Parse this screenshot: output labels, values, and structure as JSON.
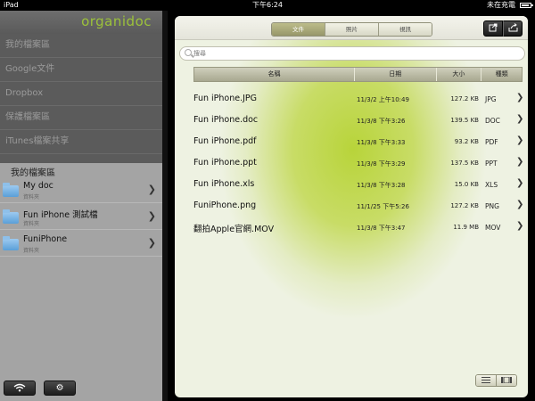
{
  "statusbar": {
    "device": "iPad",
    "time": "下午6:24",
    "charge_label": "未在充電",
    "battery_level": 0.9
  },
  "logo": "organidoc",
  "sources": [
    {
      "label": "我的檔案區",
      "active": true
    },
    {
      "label": "Google文件",
      "active": false
    },
    {
      "label": "Dropbox",
      "active": false
    },
    {
      "label": "保護檔案區",
      "active": false
    },
    {
      "label": "iTunes檔案共享",
      "active": false
    }
  ],
  "folders_label": "我的檔案區",
  "folders": [
    {
      "name": "My doc",
      "sub": "資料夾",
      "selected": false
    },
    {
      "name": "Fun iPhone 測試檔",
      "sub": "資料夾",
      "selected": true
    },
    {
      "name": "FuniPhone",
      "sub": "資料夾",
      "selected": false
    }
  ],
  "segments": [
    {
      "label": "文件",
      "active": true
    },
    {
      "label": "照片",
      "active": false
    },
    {
      "label": "視訊",
      "active": false
    }
  ],
  "search": {
    "placeholder": "搜尋"
  },
  "table": {
    "headers": {
      "name": "名稱",
      "date": "日期",
      "size": "大小",
      "type": "種類"
    },
    "rows": [
      {
        "name": "Fun iPhone.JPG",
        "date": "11/3/2 上午10:49",
        "size": "127.2 KB",
        "type": "JPG"
      },
      {
        "name": "Fun iPhone.doc",
        "date": "11/3/8 下午3:26",
        "size": "139.5 KB",
        "type": "DOC"
      },
      {
        "name": "Fun iPhone.pdf",
        "date": "11/3/8 下午3:33",
        "size": "93.2 KB",
        "type": "PDF"
      },
      {
        "name": "Fun iPhone.ppt",
        "date": "11/3/8 下午3:29",
        "size": "137.5 KB",
        "type": "PPT"
      },
      {
        "name": "Fun iPhone.xls",
        "date": "11/3/8 下午3:28",
        "size": "15.0 KB",
        "type": "XLS"
      },
      {
        "name": "FuniPhone.png",
        "date": "11/1/25 下午5:26",
        "size": "127.2 KB",
        "type": "PNG"
      },
      {
        "name": "翻拍Apple官網.MOV",
        "date": "11/3/8 下午3:47",
        "size": "11.9 MB",
        "type": "MOV"
      }
    ]
  },
  "icons": {
    "wifi": "wifi-icon",
    "gear": "gear-icon",
    "folder": "folder-icon",
    "chevron": "chevron-right-icon",
    "export": "export-icon",
    "share": "share-icon",
    "list": "list-view-icon",
    "grid": "grid-view-icon"
  },
  "colors": {
    "accent": "#9cc23a"
  }
}
